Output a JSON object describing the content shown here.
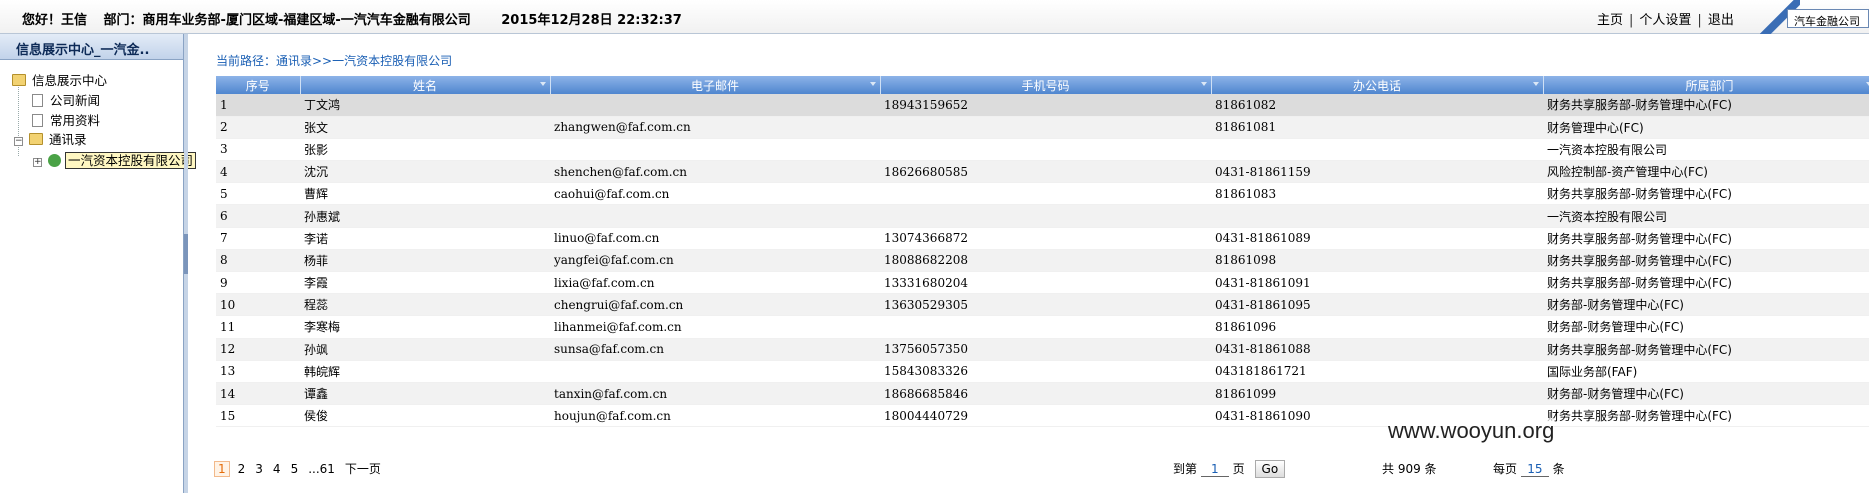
{
  "topbar": {
    "greeting": "您好！王信",
    "dept": "部门：商用车业务部-厦门区域-福建区域-一汽汽车金融有限公司",
    "datetime": "2015年12月28日  22:32:37",
    "links": [
      "主页",
      "个人设置",
      "退出"
    ],
    "company_box": "汽车金融公司"
  },
  "sidebar": {
    "title": "信息展示中心_一汽金..",
    "root": "信息展示中心",
    "items": [
      "公司新闻",
      "常用资料"
    ],
    "contacts": "通讯录",
    "selected": "一汽资本控股有限公司"
  },
  "breadcrumb": "当前路径：通讯录>>一汽资本控股有限公司",
  "table": {
    "headers": [
      "序号",
      "姓名",
      "电子邮件",
      "手机号码",
      "办公电话",
      "所属部门"
    ],
    "rows": [
      [
        "1",
        "丁文鸿",
        "",
        "18943159652",
        "81861082",
        "财务共享服务部-财务管理中心(FC)"
      ],
      [
        "2",
        "张文",
        "zhangwen@faf.com.cn",
        "",
        "81861081",
        "财务管理中心(FC)"
      ],
      [
        "3",
        "张影",
        "",
        "",
        "",
        "一汽资本控股有限公司"
      ],
      [
        "4",
        "沈沉",
        "shenchen@faf.com.cn",
        "18626680585",
        "0431-81861159",
        "风险控制部-资产管理中心(FC)"
      ],
      [
        "5",
        "曹辉",
        "caohui@faf.com.cn",
        "",
        "81861083",
        "财务共享服务部-财务管理中心(FC)"
      ],
      [
        "6",
        "孙惠斌",
        "",
        "",
        "",
        "一汽资本控股有限公司"
      ],
      [
        "7",
        "李诺",
        "linuo@faf.com.cn",
        "13074366872",
        "0431-81861089",
        "财务共享服务部-财务管理中心(FC)"
      ],
      [
        "8",
        "杨菲",
        "yangfei@faf.com.cn",
        "18088682208",
        "81861098",
        "财务共享服务部-财务管理中心(FC)"
      ],
      [
        "9",
        "李霞",
        "lixia@faf.com.cn",
        "13331680204",
        "0431-81861091",
        "财务共享服务部-财务管理中心(FC)"
      ],
      [
        "10",
        "程蕊",
        "chengrui@faf.com.cn",
        "13630529305",
        "0431-81861095",
        "财务部-财务管理中心(FC)"
      ],
      [
        "11",
        "李寒梅",
        "lihanmei@faf.com.cn",
        "",
        "81861096",
        "财务部-财务管理中心(FC)"
      ],
      [
        "12",
        "孙飒",
        "sunsa@faf.com.cn",
        "13756057350",
        "0431-81861088",
        "财务共享服务部-财务管理中心(FC)"
      ],
      [
        "13",
        "韩皖辉",
        "",
        "15843083326",
        "043181861721",
        "国际业务部(FAF)"
      ],
      [
        "14",
        "谭鑫",
        "tanxin@faf.com.cn",
        "18686685846",
        "81861099",
        "财务部-财务管理中心(FC)"
      ],
      [
        "15",
        "侯俊",
        "houjun@faf.com.cn",
        "18004440729",
        "0431-81861090",
        "财务共享服务部-财务管理中心(FC)"
      ]
    ]
  },
  "pager": {
    "current": "1",
    "pages": [
      "2",
      "3",
      "4",
      "5",
      "...61"
    ],
    "next": "下一页",
    "jump_prefix": "到第",
    "jump_value": "1",
    "jump_suffix": "页",
    "go": "Go",
    "total": "共 909 条",
    "perpage_prefix": "每页",
    "perpage_value": "15",
    "perpage_suffix": "条"
  },
  "watermark": "www.wooyun.org"
}
